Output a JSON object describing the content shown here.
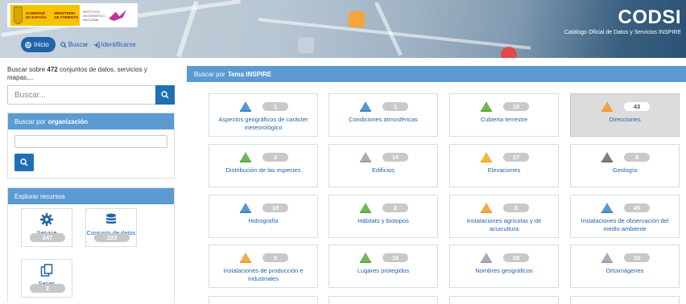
{
  "colors": {
    "primary": "#1f63a8",
    "panel_header": "#5b9bd1",
    "badge": "#c9c9c9",
    "active_card": "#dcdcdc",
    "accent_orange": "#f6a53a"
  },
  "header": {
    "brand_title": "CODSI",
    "brand_subtitle": "Catálogo Oficial de Datos y Servicios INSPIRE",
    "gov_logo_text": "GOBIERNO DE ESPAÑA",
    "ministry_text": "MINISTERIO DE FOMENTO",
    "agency_text": "INSTITUTO GEOGRÁFICO NACIONAL",
    "nav": [
      {
        "label": "Inicio",
        "icon": "globe-icon"
      },
      {
        "label": "Buscar",
        "icon": "search-icon"
      },
      {
        "label": "Identificarse",
        "icon": "login-icon"
      }
    ]
  },
  "sidebar": {
    "search_prefix": "Buscar sobre",
    "search_count": "472",
    "search_suffix": "conjuntos de datos, servicios y mapas,...",
    "search_placeholder": "Buscar...",
    "org_panel": {
      "prefix": "Buscar por",
      "bold": "organización"
    },
    "resources_panel": {
      "title": "Explorar recursos"
    },
    "resources": [
      {
        "label": "Service",
        "count": "247",
        "icon": "gear-icon"
      },
      {
        "label": "Conjunto de datos",
        "count": "223",
        "icon": "database-icon"
      },
      {
        "label": "Series",
        "count": "2",
        "icon": "series-icon"
      }
    ]
  },
  "main": {
    "head_prefix": "Buscar por",
    "head_bold": "Tema INSPIRE",
    "themes": [
      {
        "label": "Aspectos geográficos de carácter meteorológico",
        "count": "1",
        "icon": "meteo-icon",
        "active": false
      },
      {
        "label": "Condiciones atmosféricas",
        "count": "1",
        "icon": "atmosphere-icon",
        "active": false
      },
      {
        "label": "Cubierta terrestre",
        "count": "15",
        "icon": "land-cover-icon",
        "active": false
      },
      {
        "label": "Direcciones",
        "count": "43",
        "icon": "addresses-icon",
        "active": true
      },
      {
        "label": "Distribución de las especies",
        "count": "3",
        "icon": "species-icon",
        "active": false
      },
      {
        "label": "Edificios",
        "count": "14",
        "icon": "buildings-icon",
        "active": false
      },
      {
        "label": "Elevaciones",
        "count": "17",
        "icon": "elevation-icon",
        "active": false
      },
      {
        "label": "Geología",
        "count": "5",
        "icon": "geology-icon",
        "active": false
      },
      {
        "label": "Hidrografía",
        "count": "18",
        "icon": "hydrography-icon",
        "active": false
      },
      {
        "label": "Hábitats y biotopos",
        "count": "2",
        "icon": "habitats-icon",
        "active": false
      },
      {
        "label": "Instalaciones agrícolas y de acuicultura",
        "count": "5",
        "icon": "agricultural-icon",
        "active": false
      },
      {
        "label": "Instalaciones de observación del medio ambiente",
        "count": "45",
        "icon": "env-monitoring-icon",
        "active": false
      },
      {
        "label": "Instalaciones de producción e industriales",
        "count": "5",
        "icon": "industrial-icon",
        "active": false
      },
      {
        "label": "Lugares protegidos",
        "count": "18",
        "icon": "protected-sites-icon",
        "active": false
      },
      {
        "label": "Nombres geográficos",
        "count": "18",
        "icon": "geo-names-icon",
        "active": false
      },
      {
        "label": "Ortoimágenes",
        "count": "10",
        "icon": "orthoimagery-icon",
        "active": false
      }
    ]
  }
}
